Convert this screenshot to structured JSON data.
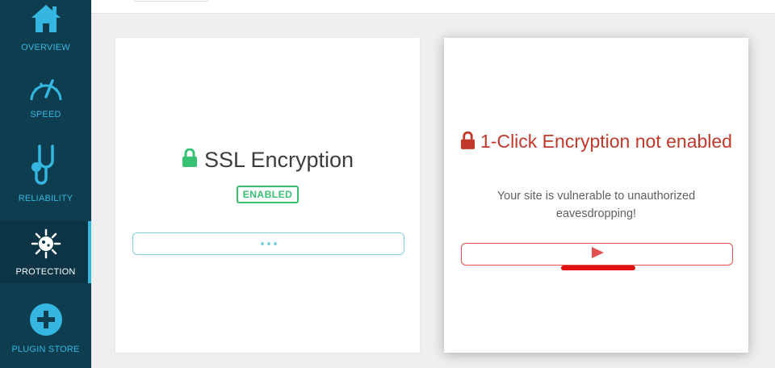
{
  "sidebar": {
    "items": [
      {
        "label": "OVERVIEW",
        "icon": "home-icon"
      },
      {
        "label": "SPEED",
        "icon": "speedometer-icon"
      },
      {
        "label": "RELIABILITY",
        "icon": "stethoscope-icon"
      },
      {
        "label": "PROTECTION",
        "icon": "virus-icon",
        "active": true
      },
      {
        "label": "PLUGIN STORE",
        "icon": "plus-circle-icon"
      }
    ]
  },
  "ssl_card": {
    "title": "SSL Encryption",
    "badge": "ENABLED",
    "lock_icon": "lock-icon"
  },
  "encryption_card": {
    "title": "1-Click Encryption not enabled",
    "description": "Your site is vulnerable to unauthorized eavesdropping!",
    "lock_icon": "lock-icon"
  },
  "colors": {
    "sidebar_bg": "#0d3d4f",
    "accent": "#35b6e0",
    "success": "#38c172",
    "danger": "#c0392b"
  }
}
